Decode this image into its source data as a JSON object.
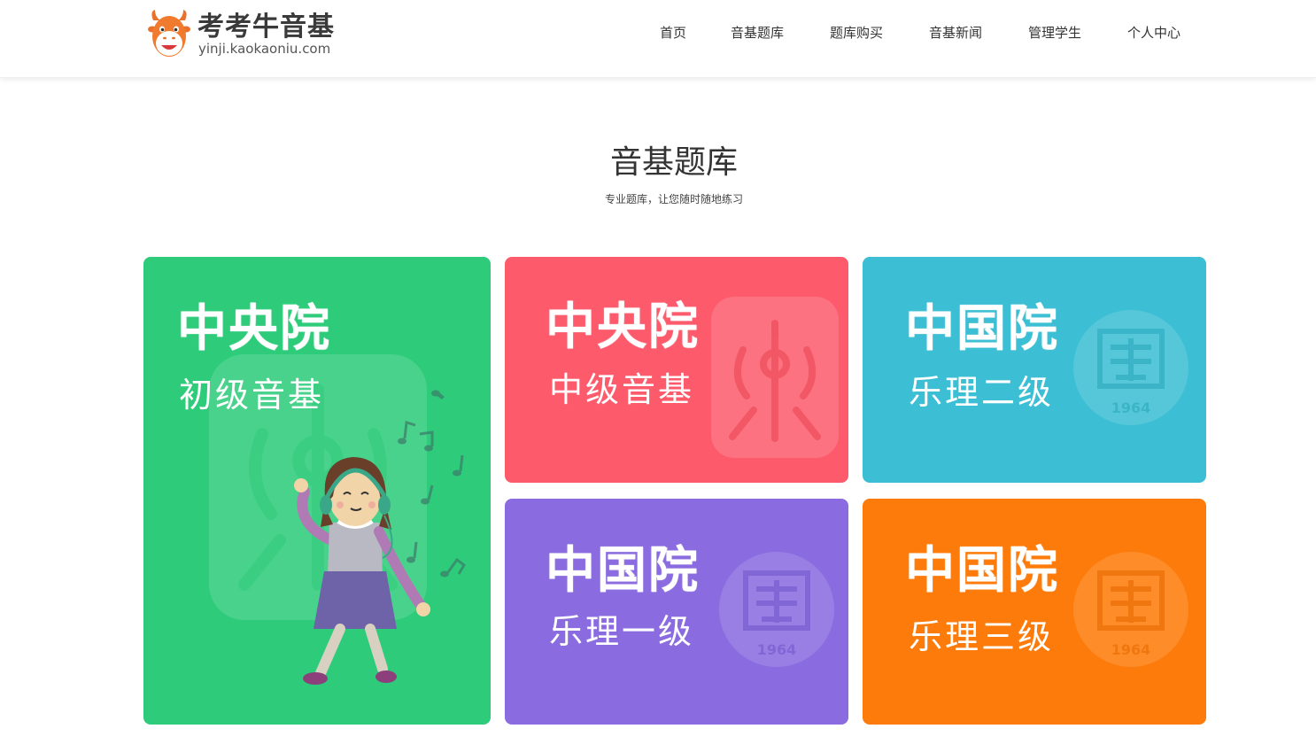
{
  "header": {
    "logo": {
      "name": "考考牛音基",
      "domain": "yinji.kaokaoniu.com"
    },
    "nav": [
      {
        "label": "首页"
      },
      {
        "label": "音基题库"
      },
      {
        "label": "题库购买"
      },
      {
        "label": "音基新闻"
      },
      {
        "label": "管理学生"
      },
      {
        "label": "个人中心"
      }
    ]
  },
  "section": {
    "title": "音基题库",
    "subtitle": "专业题库，让您随时随地练习"
  },
  "cards": [
    {
      "school": "中央院",
      "level": "初级音基",
      "color": "#2ecc7a",
      "icon": "yue-seal-icon"
    },
    {
      "school": "中央院",
      "level": "中级音基",
      "color": "#fd5b6c",
      "icon": "yue-seal-icon"
    },
    {
      "school": "中国院",
      "level": "乐理二级",
      "color": "#3cbfd4",
      "icon": "guo-seal-icon"
    },
    {
      "school": "中国院",
      "level": "乐理一级",
      "color": "#8a6ce0",
      "icon": "guo-seal-icon"
    },
    {
      "school": "中国院",
      "level": "乐理三级",
      "color": "#fd7b0a",
      "icon": "guo-seal-icon"
    }
  ],
  "seal_year": "1964"
}
